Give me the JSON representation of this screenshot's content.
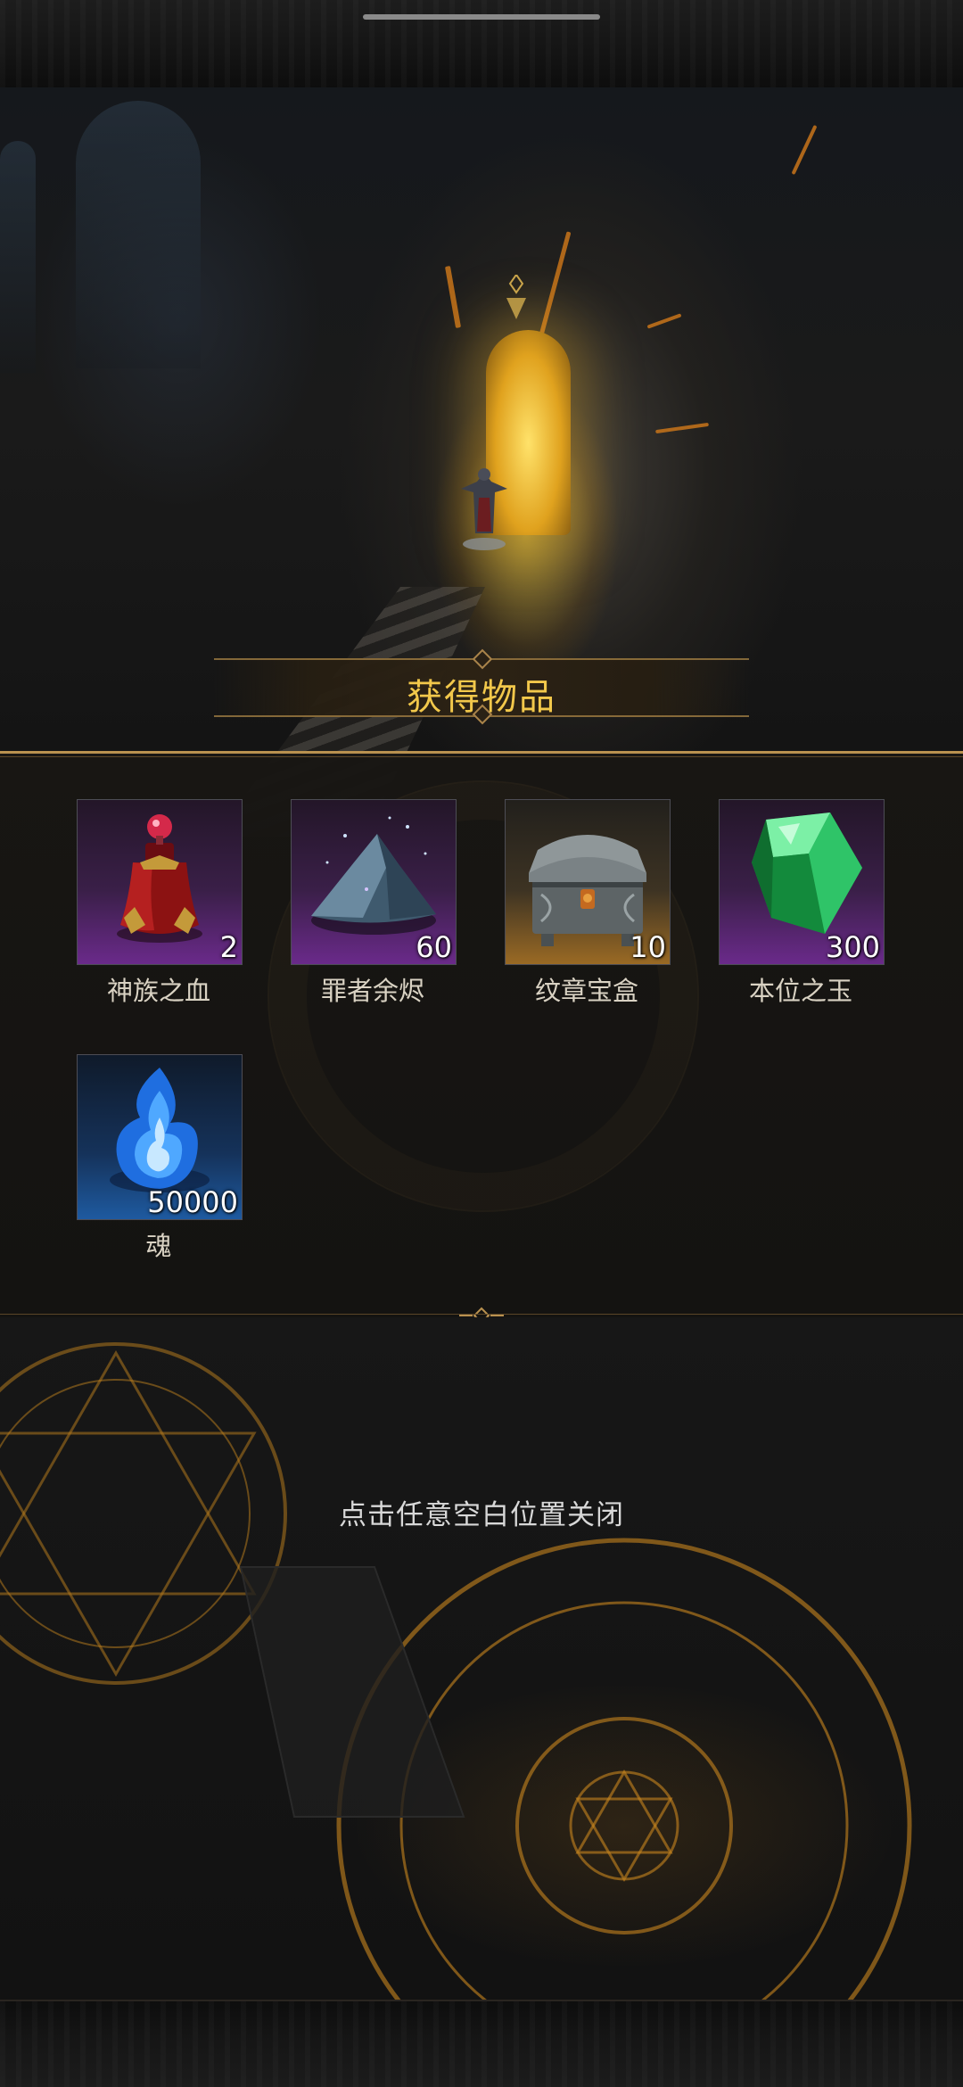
{
  "title": "获得物品",
  "items": [
    {
      "name": "神族之血",
      "count": "2",
      "rarity": "purple",
      "icon": "blood-potion-icon"
    },
    {
      "name": "罪者余烬",
      "count": "60",
      "rarity": "purple",
      "icon": "ember-pile-icon"
    },
    {
      "name": "纹章宝盒",
      "count": "10",
      "rarity": "gold",
      "icon": "ornate-chest-icon"
    },
    {
      "name": "本位之玉",
      "count": "300",
      "rarity": "purple",
      "icon": "green-gem-icon"
    },
    {
      "name": "魂",
      "count": "50000",
      "rarity": "blue",
      "icon": "blue-soul-flame-icon"
    }
  ],
  "close_hint": "点击任意空白位置关闭",
  "colors": {
    "title_gold": "#f2c84b",
    "panel_border": "#b9914f",
    "rarity_purple": "#6a2a8a",
    "rarity_gold": "#9a6a24",
    "rarity_blue": "#1e5aa0"
  }
}
